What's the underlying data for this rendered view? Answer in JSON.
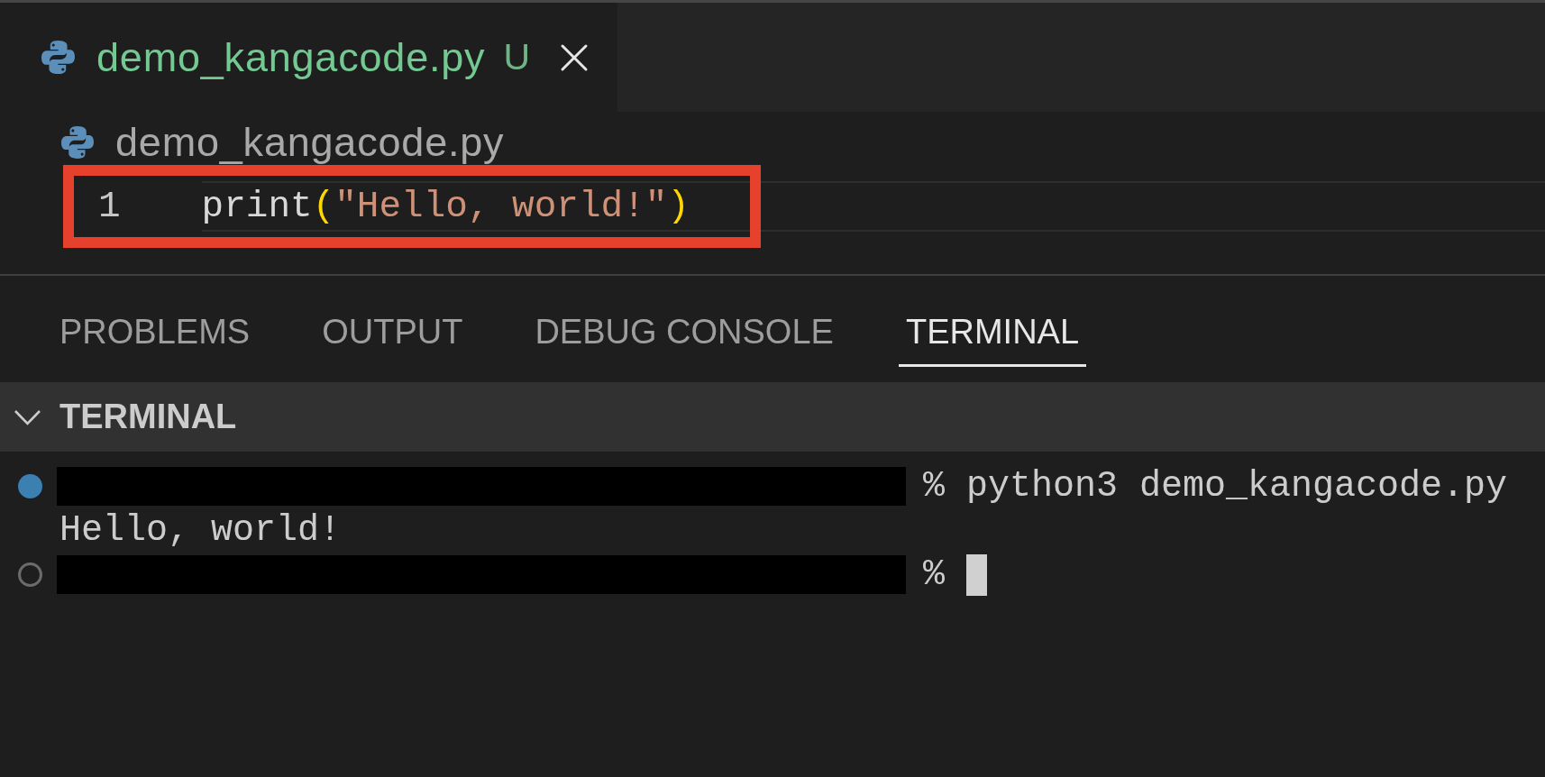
{
  "editor_tabs": [
    {
      "label": "demo_kangacode.py",
      "badge": "U",
      "selected": true
    }
  ],
  "breadcrumb": {
    "file": "demo_kangacode.py"
  },
  "editor": {
    "lines": [
      {
        "number": "1",
        "current": true,
        "annotated": true,
        "tokens": [
          {
            "kind": "function",
            "text": "print"
          },
          {
            "kind": "bracket",
            "text": "("
          },
          {
            "kind": "string",
            "text": "\"Hello, world!\""
          },
          {
            "kind": "bracket",
            "text": ")"
          }
        ]
      }
    ]
  },
  "panel_tabs": [
    {
      "label": "PROBLEMS",
      "selected": false
    },
    {
      "label": "OUTPUT",
      "selected": false
    },
    {
      "label": "DEBUG CONSOLE",
      "selected": false
    },
    {
      "label": "TERMINAL",
      "selected": true
    }
  ],
  "terminal": {
    "title": "TERMINAL",
    "expanded": true,
    "lines": [
      {
        "kind": "prompt",
        "finished": true,
        "redacted": true,
        "text": "% python3 demo_kangacode.py",
        "cursor": false
      },
      {
        "kind": "output",
        "text": "Hello, world!"
      },
      {
        "kind": "prompt",
        "finished": false,
        "redacted": true,
        "text": "%",
        "cursor": true
      }
    ]
  }
}
